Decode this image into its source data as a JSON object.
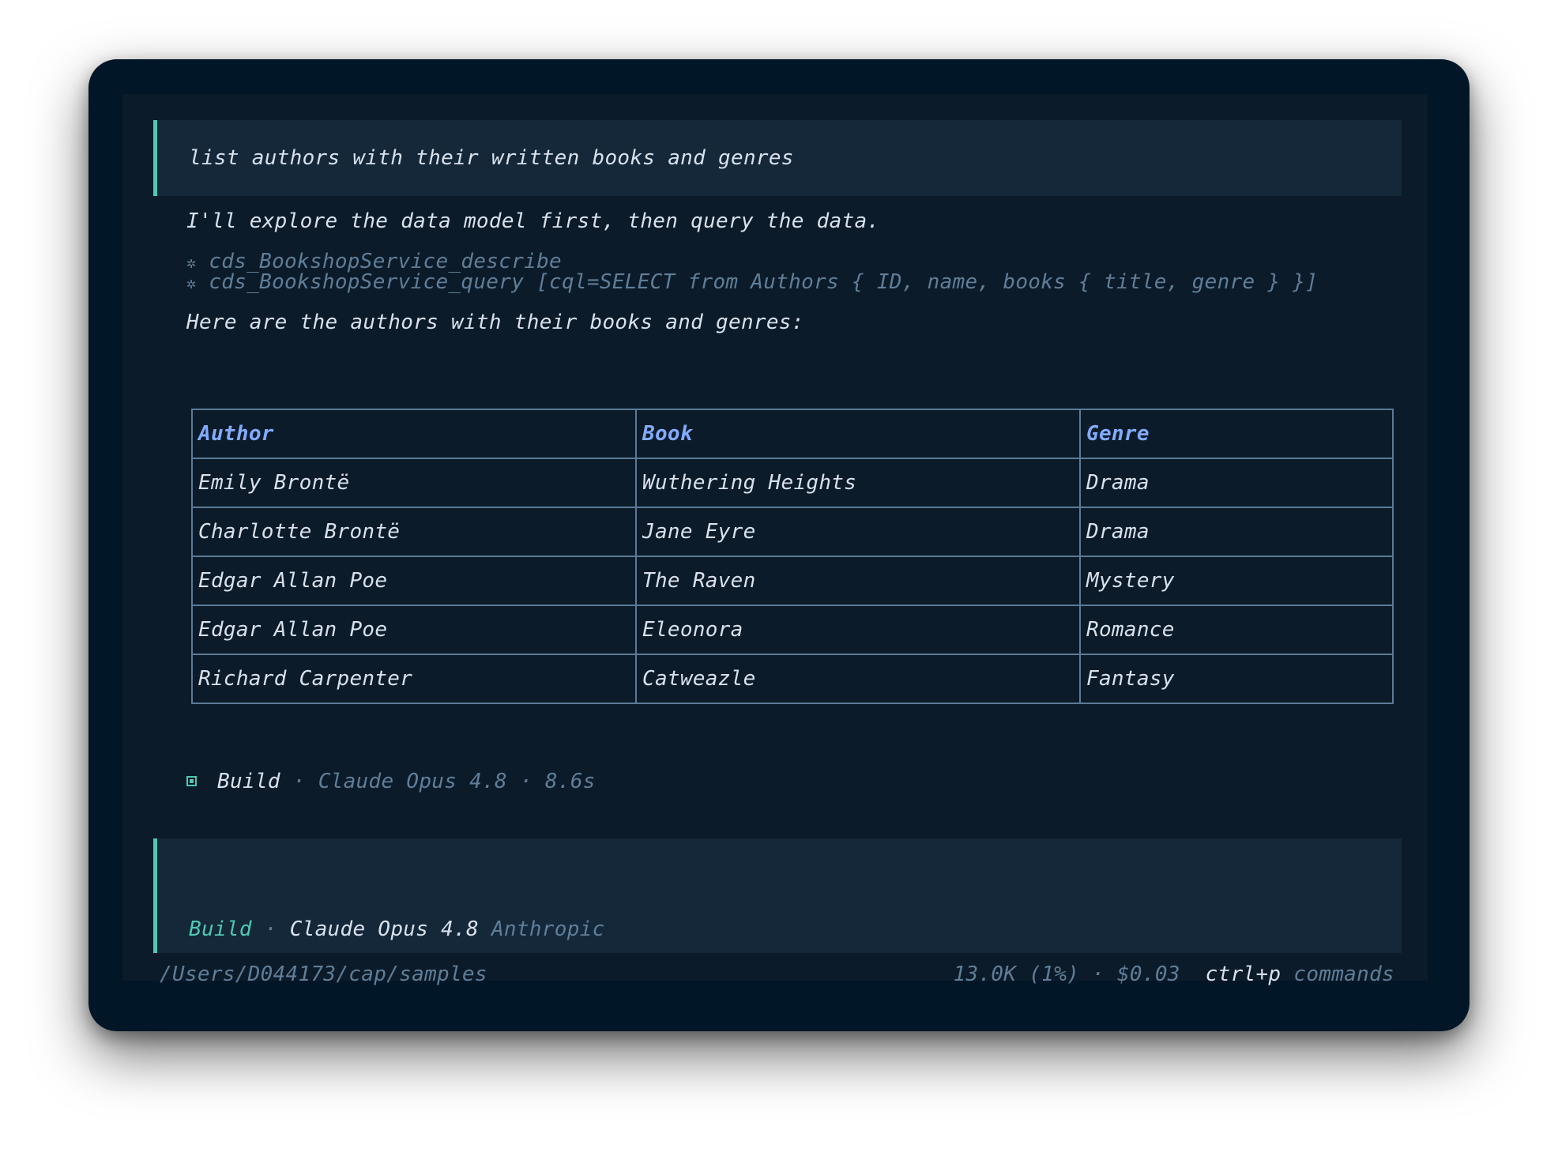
{
  "user_prompt": "list authors with their written books and genres",
  "assistant": {
    "intro": "I'll explore the data model first, then query the data.",
    "tool_calls": [
      {
        "icon": "gear-icon",
        "glyph": "✲",
        "text": "cds_BookshopService_describe"
      },
      {
        "icon": "gear-icon",
        "glyph": "✲",
        "text": "cds_BookshopService_query [cql=SELECT from Authors { ID, name, books { title, genre } }]"
      }
    ],
    "summary": "Here are the authors with their books and genres:"
  },
  "table": {
    "headers": [
      "Author",
      "Book",
      "Genre"
    ],
    "rows": [
      [
        "Emily Brontë",
        "Wuthering Heights",
        "Drama"
      ],
      [
        "Charlotte Brontë",
        "Jane Eyre",
        "Drama"
      ],
      [
        "Edgar Allan Poe",
        "The Raven",
        "Mystery"
      ],
      [
        "Edgar Allan Poe",
        "Eleonora",
        "Romance"
      ],
      [
        "Richard Carpenter",
        "Catweazle",
        "Fantasy"
      ]
    ]
  },
  "status": {
    "mode": "Build",
    "sep": "·",
    "model": "Claude Opus 4.8",
    "duration": "8.6s"
  },
  "input": {
    "mode": "Build",
    "sep": "·",
    "model": "Claude Opus 4.8",
    "provider": "Anthropic"
  },
  "footer": {
    "path": "/Users/D044173/cap/samples",
    "usage": "13.0K (1%) · $0.03",
    "shortcut_key": "ctrl+p",
    "shortcut_label": "commands"
  },
  "colors": {
    "accent": "#4ec9b0",
    "header_text": "#82aaff",
    "muted": "#5f7e98",
    "text": "#d8e1ec",
    "window_bg": "#011627"
  }
}
